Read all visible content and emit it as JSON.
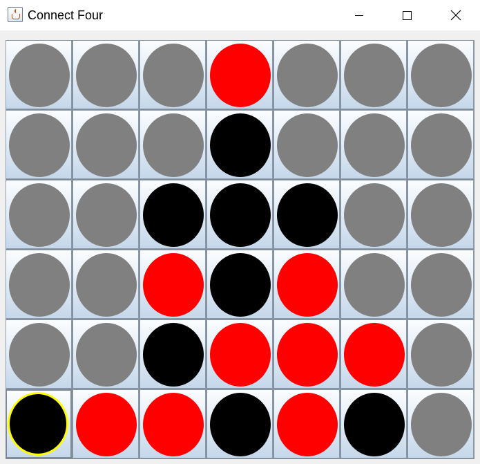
{
  "window": {
    "title": "Connect Four",
    "controls": {
      "minimize": "minimize-icon",
      "maximize": "maximize-icon",
      "close": "close-icon"
    }
  },
  "colors": {
    "empty": "#808080",
    "red": "#ff0000",
    "black": "#000000",
    "highlight": "#ffff00"
  },
  "board": {
    "rows": 6,
    "columns": 7,
    "highlighted_cell": {
      "row": 5,
      "col": 0
    },
    "cells": [
      [
        "empty",
        "empty",
        "empty",
        "red",
        "empty",
        "empty",
        "empty"
      ],
      [
        "empty",
        "empty",
        "empty",
        "black",
        "empty",
        "empty",
        "empty"
      ],
      [
        "empty",
        "empty",
        "black",
        "black",
        "black",
        "empty",
        "empty"
      ],
      [
        "empty",
        "empty",
        "red",
        "black",
        "red",
        "empty",
        "empty"
      ],
      [
        "empty",
        "empty",
        "black",
        "red",
        "red",
        "red",
        "empty"
      ],
      [
        "black",
        "red",
        "red",
        "black",
        "red",
        "black",
        "empty"
      ]
    ]
  }
}
